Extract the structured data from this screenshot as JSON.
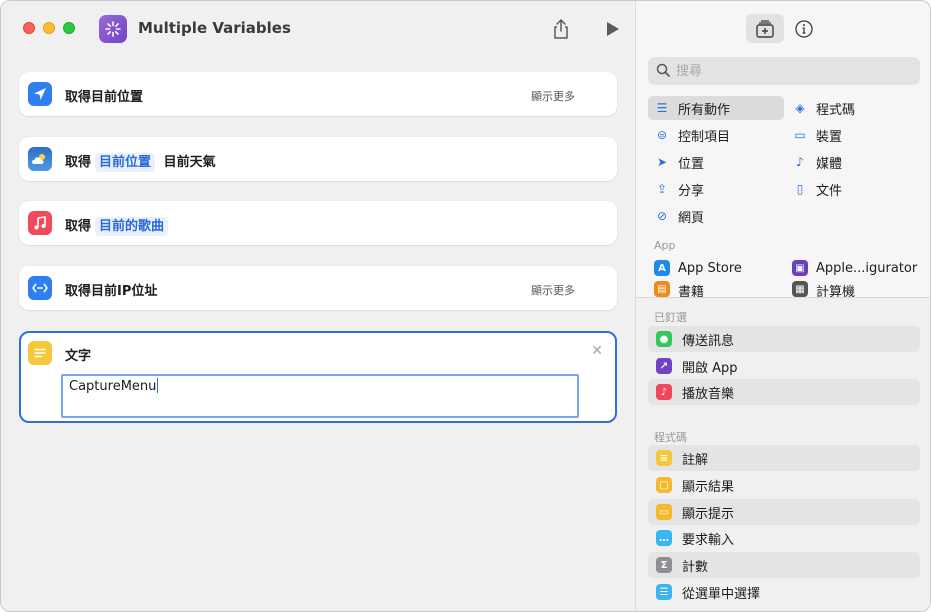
{
  "window": {
    "title": "Multiple Variables"
  },
  "actions": [
    {
      "label": "取得目前位置",
      "more": "顯示更多"
    },
    {
      "label": "取得",
      "token": "目前位置",
      "suffix": "目前天氣"
    },
    {
      "label": "取得",
      "token": "目前的歌曲"
    },
    {
      "label": "取得目前IP位址",
      "more": "顯示更多"
    }
  ],
  "text_action": {
    "label": "文字",
    "value": "CaptureMenu"
  },
  "library": {
    "search_placeholder": "搜尋",
    "categories": [
      {
        "label": "所有動作",
        "icon": "list-icon",
        "selected": true
      },
      {
        "label": "程式碼",
        "icon": "scripting-icon"
      },
      {
        "label": "控制項目",
        "icon": "toggles-icon"
      },
      {
        "label": "裝置",
        "icon": "display-icon"
      },
      {
        "label": "位置",
        "icon": "location-icon"
      },
      {
        "label": "媒體",
        "icon": "music-note-icon"
      },
      {
        "label": "分享",
        "icon": "share-icon"
      },
      {
        "label": "文件",
        "icon": "document-icon"
      },
      {
        "label": "網頁",
        "icon": "compass-icon"
      }
    ],
    "apps_header": "App",
    "apps": [
      {
        "label": "App Store",
        "icon": "app-store-icon",
        "color": "#1a8cf0"
      },
      {
        "label": "Apple...igurator",
        "icon": "configurator-icon",
        "color": "#6b3fb8"
      },
      {
        "label": "書籍",
        "icon": "books-icon",
        "color": "#f08a1c"
      },
      {
        "label": "計算機",
        "icon": "calculator-icon",
        "color": "#555555"
      }
    ],
    "pinned_header": "已釘選",
    "pinned": [
      {
        "label": "傳送訊息",
        "icon": "messages-icon",
        "color": "#34c759"
      },
      {
        "label": "開啟 App",
        "icon": "open-app-icon",
        "color": "#6e43c4"
      },
      {
        "label": "播放音樂",
        "icon": "music-icon",
        "color": "#f2455b"
      }
    ],
    "scripting_header": "程式碼",
    "scripting": [
      {
        "label": "註解",
        "icon": "comment-icon",
        "color": "#f5c83c"
      },
      {
        "label": "顯示結果",
        "icon": "show-result-icon",
        "color": "#f5b82e"
      },
      {
        "label": "顯示提示",
        "icon": "show-alert-icon",
        "color": "#f5b82e"
      },
      {
        "label": "要求輸入",
        "icon": "ask-input-icon",
        "color": "#3ab5f0"
      },
      {
        "label": "計數",
        "icon": "count-icon",
        "color": "#8e8e93"
      },
      {
        "label": "從選單中選擇",
        "icon": "choose-menu-icon",
        "color": "#3ab5f0"
      }
    ]
  }
}
